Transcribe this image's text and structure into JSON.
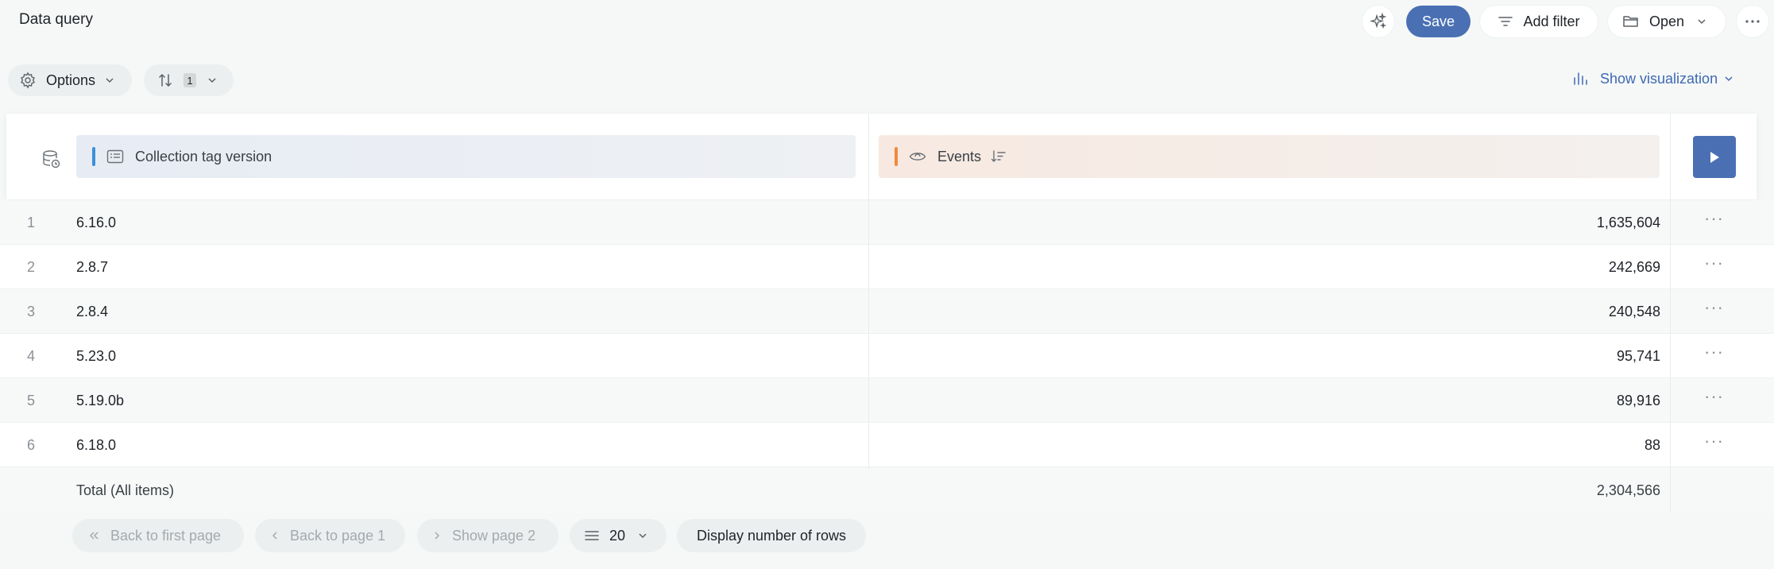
{
  "header": {
    "title": "Data query",
    "save_label": "Save",
    "add_filter_label": "Add filter",
    "open_label": "Open"
  },
  "toolbar": {
    "options_label": "Options",
    "sort_count": "1",
    "show_visualization_label": "Show visualization"
  },
  "columns": {
    "dimension": "Collection tag version",
    "metric": "Events"
  },
  "rows": [
    {
      "index": "1",
      "version": "6.16.0",
      "events": "1,635,604"
    },
    {
      "index": "2",
      "version": "2.8.7",
      "events": "242,669"
    },
    {
      "index": "3",
      "version": "2.8.4",
      "events": "240,548"
    },
    {
      "index": "4",
      "version": "5.23.0",
      "events": "95,741"
    },
    {
      "index": "5",
      "version": "5.19.0b",
      "events": "89,916"
    },
    {
      "index": "6",
      "version": "6.18.0",
      "events": "88"
    }
  ],
  "total": {
    "label": "Total (All items)",
    "value": "2,304,566"
  },
  "pagination": {
    "first_label": "Back to first page",
    "prev_label": "Back to page 1",
    "next_label": "Show page 2",
    "page_size": "20",
    "display_rows_label": "Display number of rows"
  },
  "icons": {
    "ai": "sparkles-icon",
    "add_filter": "filter-lines-icon",
    "open": "folder-icon",
    "more": "more-horizontal-icon",
    "options": "gear-icon",
    "sort": "sort-arrows-icon",
    "viz": "bar-chart-icon",
    "database": "database-icon",
    "dimension": "list-icon",
    "metric": "eye-icon",
    "run": "play-icon"
  },
  "colors": {
    "accent": "#4a70b3",
    "link": "#3f68b3",
    "dimension_bar": "#3d90d9",
    "metric_bar": "#f08a3c"
  }
}
